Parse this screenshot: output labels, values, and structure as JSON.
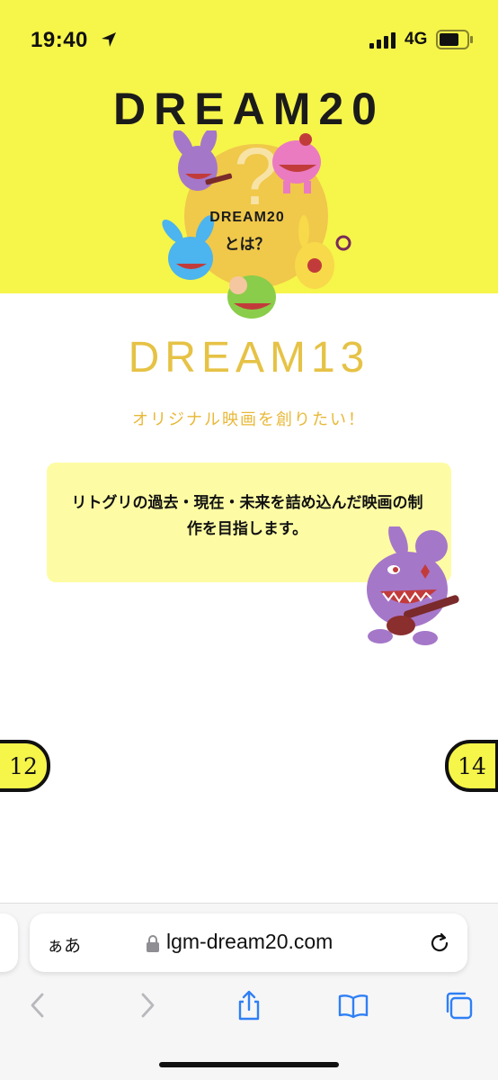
{
  "status_bar": {
    "time": "19:40",
    "network": "4G"
  },
  "hero": {
    "logo": "DREAM20",
    "circle_title": "DREAM20",
    "circle_subtitle": "とは？"
  },
  "main": {
    "title": "DREAM13",
    "subtitle": "オリジナル映画を創りたい！",
    "description": "リトグリの過去・現在・未来を詰め込んだ映画の制作を目指します。"
  },
  "pagination": {
    "prev": "12",
    "next": "14"
  },
  "browser": {
    "aa_label": "ぁあ",
    "url": "lgm-dream20.com"
  },
  "colors": {
    "brand_yellow": "#f6f54a",
    "title_gold": "#e6c245",
    "box_yellow": "#fdfca4",
    "accent_blue": "#2f7ff5"
  }
}
